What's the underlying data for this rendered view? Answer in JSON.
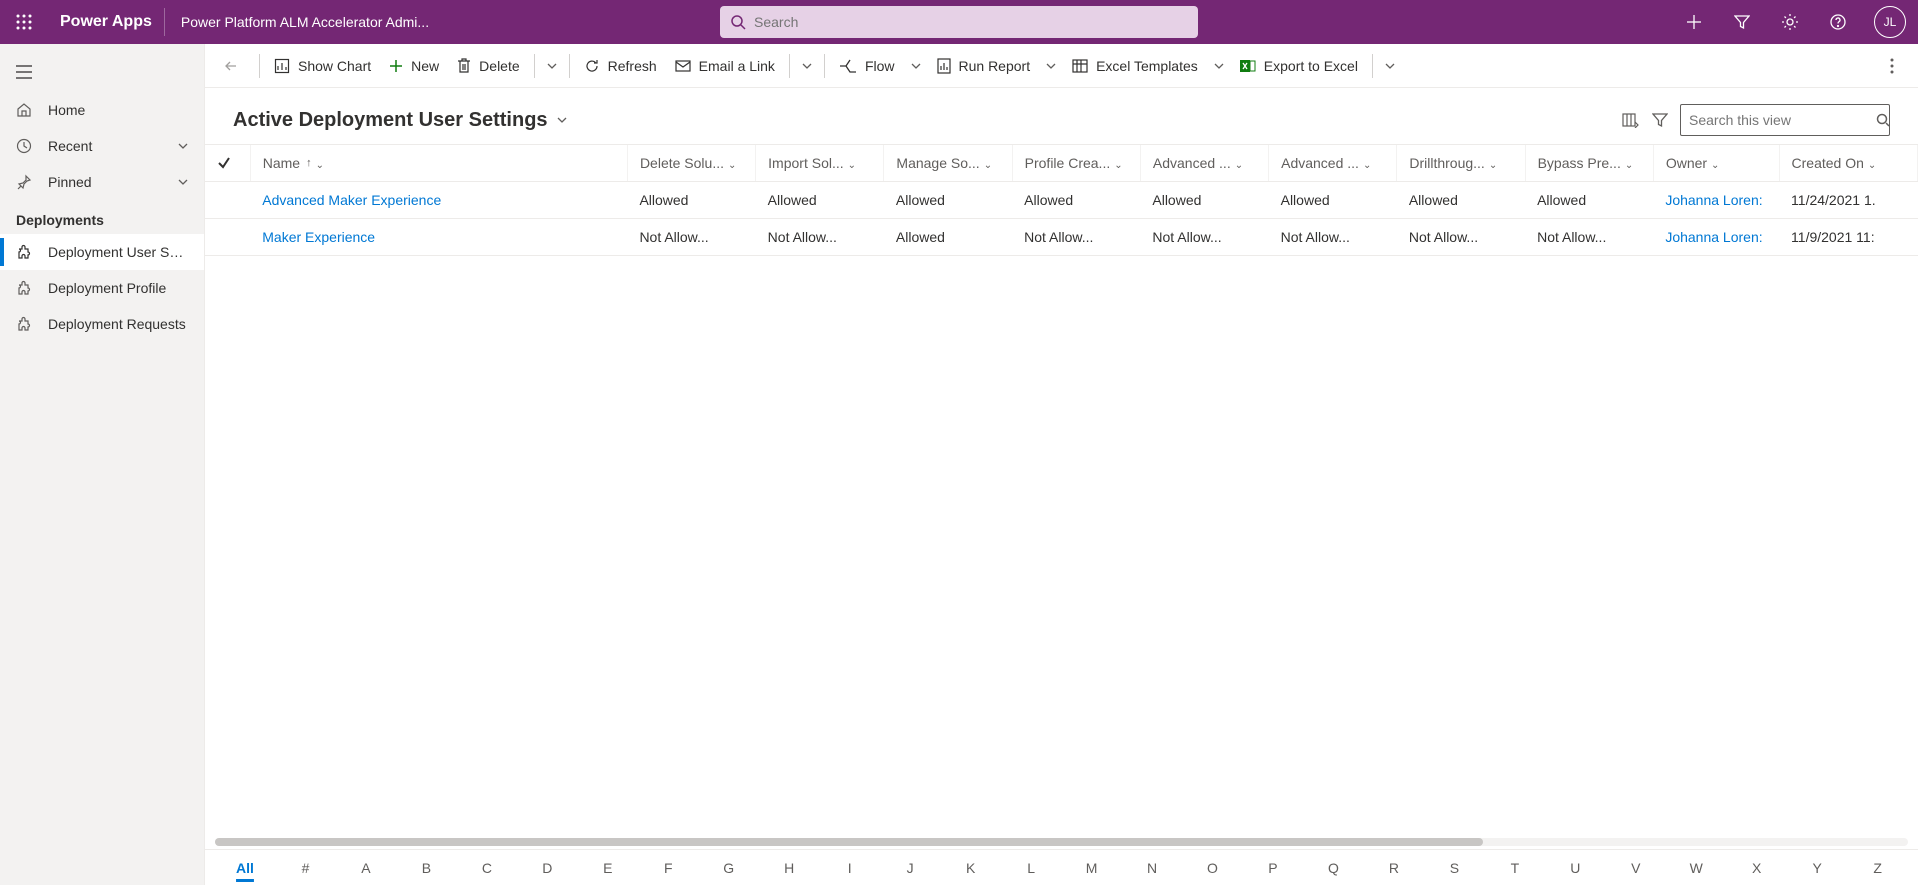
{
  "header": {
    "appname": "Power Apps",
    "breadcrumb": "Power Platform ALM Accelerator Admi...",
    "search_placeholder": "Search",
    "avatar_initials": "JL"
  },
  "sidebar": {
    "home": "Home",
    "recent": "Recent",
    "pinned": "Pinned",
    "section": "Deployments",
    "items": [
      {
        "label": "Deployment User Se...",
        "active": true
      },
      {
        "label": "Deployment Profile",
        "active": false
      },
      {
        "label": "Deployment Requests",
        "active": false
      }
    ]
  },
  "commands": {
    "show_chart": "Show Chart",
    "new": "New",
    "delete": "Delete",
    "refresh": "Refresh",
    "email_link": "Email a Link",
    "flow": "Flow",
    "run_report": "Run Report",
    "excel_templates": "Excel Templates",
    "export_excel": "Export to Excel"
  },
  "view": {
    "title": "Active Deployment User Settings",
    "search_placeholder": "Search this view"
  },
  "grid": {
    "columns": [
      "Name",
      "Delete Solu...",
      "Import Sol...",
      "Manage So...",
      "Profile Crea...",
      "Advanced ...",
      "Advanced ...",
      "Drillthroug...",
      "Bypass Pre...",
      "Owner",
      "Created On"
    ],
    "rows": [
      {
        "name": "Advanced Maker Experience",
        "c": [
          "Allowed",
          "Allowed",
          "Allowed",
          "Allowed",
          "Allowed",
          "Allowed",
          "Allowed",
          "Allowed"
        ],
        "owner": "Johanna Loren:",
        "created": "11/24/2021 1."
      },
      {
        "name": "Maker Experience",
        "c": [
          "Not Allow...",
          "Not Allow...",
          "Allowed",
          "Not Allow...",
          "Not Allow...",
          "Not Allow...",
          "Not Allow...",
          "Not Allow..."
        ],
        "owner": "Johanna Loren:",
        "created": "11/9/2021 11:"
      }
    ]
  },
  "alphabar": [
    "All",
    "#",
    "A",
    "B",
    "C",
    "D",
    "E",
    "F",
    "G",
    "H",
    "I",
    "J",
    "K",
    "L",
    "M",
    "N",
    "O",
    "P",
    "Q",
    "R",
    "S",
    "T",
    "U",
    "V",
    "W",
    "X",
    "Y",
    "Z"
  ]
}
